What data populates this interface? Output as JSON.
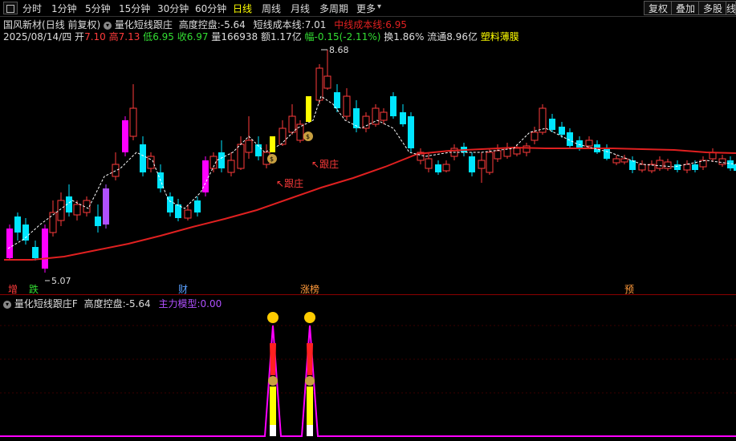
{
  "toolbar": {
    "periods": [
      "分时",
      "1分钟",
      "5分钟",
      "15分钟",
      "30分钟",
      "60分钟",
      "日线",
      "周线",
      "月线",
      "多周期",
      "更多"
    ],
    "active_period": "日线",
    "right_buttons": [
      "复权",
      "叠加",
      "多股",
      "线"
    ]
  },
  "header": {
    "stock_name": "国风新材",
    "adjust_mode": "(日线 前复权)",
    "indicator_name": "量化短线跟庄",
    "height_label": "高度控盘:",
    "height_value": "-5.64",
    "cost_label": "短线成本线:",
    "cost_value": "7.01",
    "mid_cost_label": "中线成本线:",
    "mid_cost_value": "6.95"
  },
  "quote": {
    "date": "2025/08/14/四",
    "open_label": "开",
    "open": "7.10",
    "high_label": "高",
    "high": "7.13",
    "low_label": "低",
    "low": "6.95",
    "close_label": "收",
    "close": "6.97",
    "volume_label": "量",
    "volume": "166938",
    "amount_label": "额",
    "amount": "1.17亿",
    "change_label": "幅",
    "change": "-0.15(-2.11%)",
    "turnover_label": "换",
    "turnover": "1.86%",
    "float_label": "流通",
    "float": "8.96亿",
    "sector": "塑料薄膜"
  },
  "main_chart": {
    "price_max_label": "8.68",
    "price_min_label": "5.07",
    "annotations": [
      "跟庄",
      "跟庄"
    ],
    "event_markers": [
      "增",
      "跌",
      "财",
      "涨榜",
      "预"
    ]
  },
  "sub_panel": {
    "indicator_name": "量化短线跟庄F",
    "height_label": "高度控盘:",
    "height_value": "-5.64",
    "model_label": "主力模型:",
    "model_value": "0.00"
  },
  "colors": {
    "up": "#ff3b3b",
    "down": "#00e5ff",
    "ma": "#e02020",
    "highlight": "#ffff00",
    "purple": "#b050ff",
    "magenta": "#ff00ff",
    "green": "#33dd33"
  }
}
